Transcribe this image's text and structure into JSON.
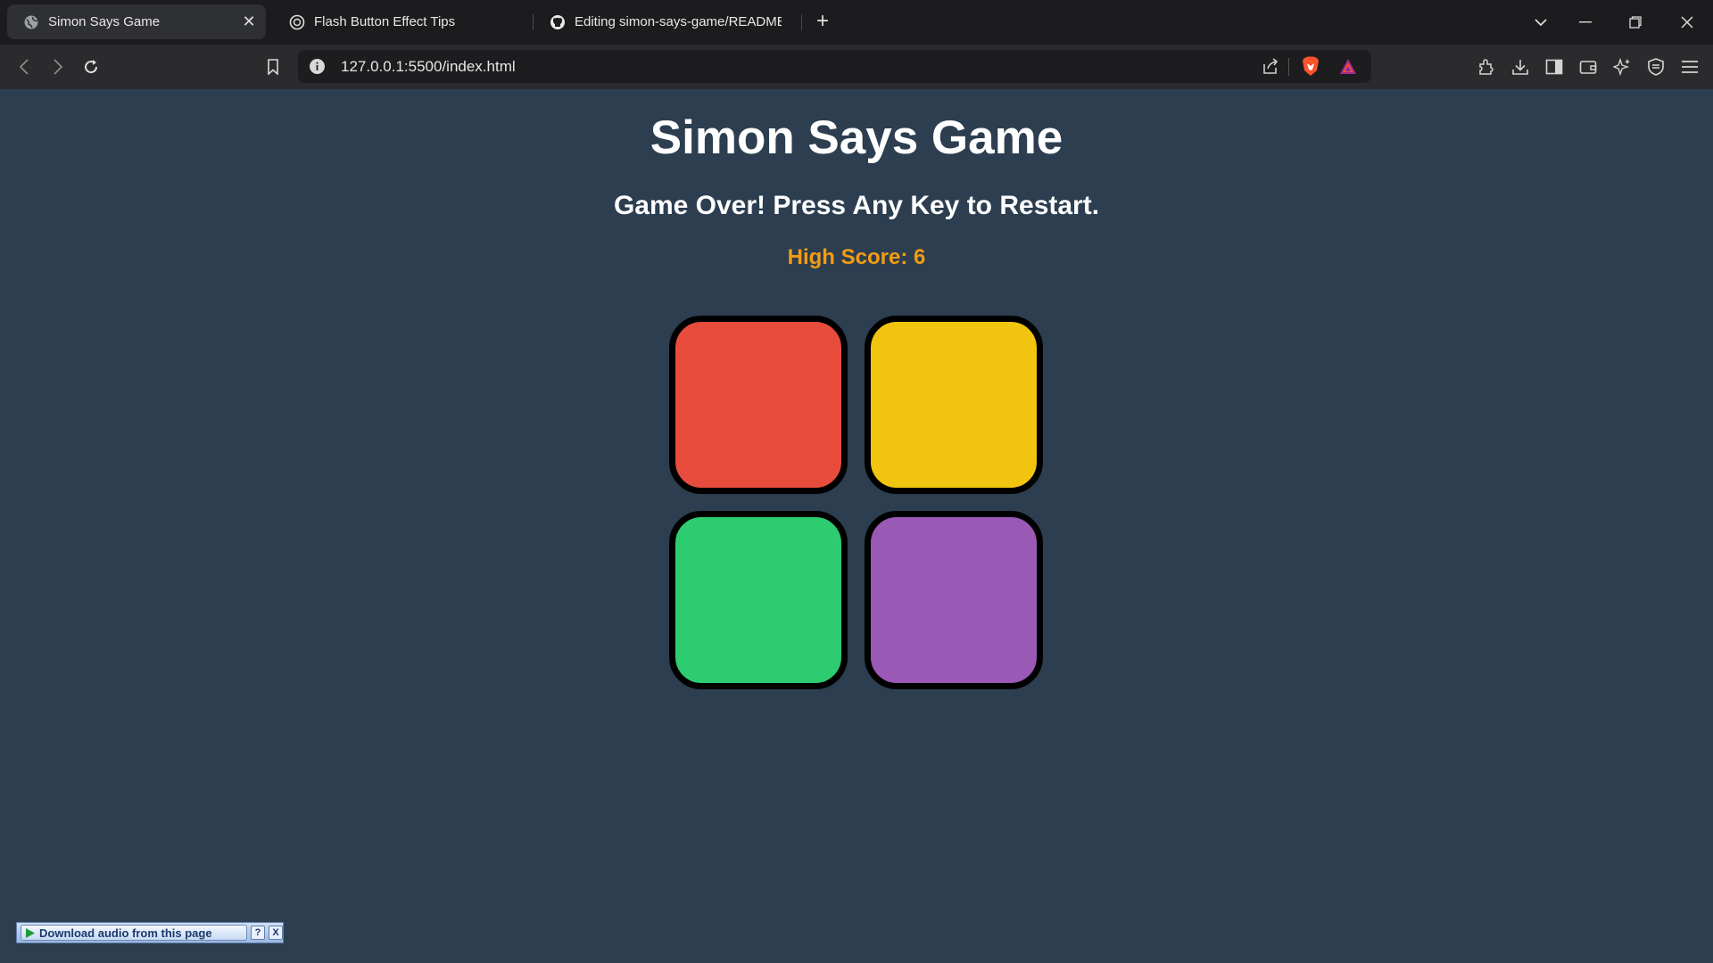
{
  "browser": {
    "tabs": [
      {
        "title": "Simon Says Game",
        "icon": "globe-icon",
        "active": true
      },
      {
        "title": "Flash Button Effect Tips",
        "icon": "chatgpt-icon",
        "active": false
      },
      {
        "title": "Editing simon-says-game/README.",
        "icon": "github-icon",
        "active": false
      }
    ],
    "url": "127.0.0.1:5500/index.html"
  },
  "game": {
    "title": "Simon Says Game",
    "status": "Game Over! Press Any Key to Restart.",
    "high_score": "High Score: 6",
    "pads": [
      {
        "color_name": "red",
        "color": "#e74c3c"
      },
      {
        "color_name": "yellow",
        "color": "#f1c40f"
      },
      {
        "color_name": "green",
        "color": "#2ecc71"
      },
      {
        "color_name": "purple",
        "color": "#9b59b6"
      }
    ],
    "colors": {
      "background": "#2c3e50",
      "title": "#ffffff",
      "high_score": "#f39c12"
    }
  },
  "extension_bar": {
    "label": "Download audio from this page",
    "help": "?",
    "close": "X"
  }
}
